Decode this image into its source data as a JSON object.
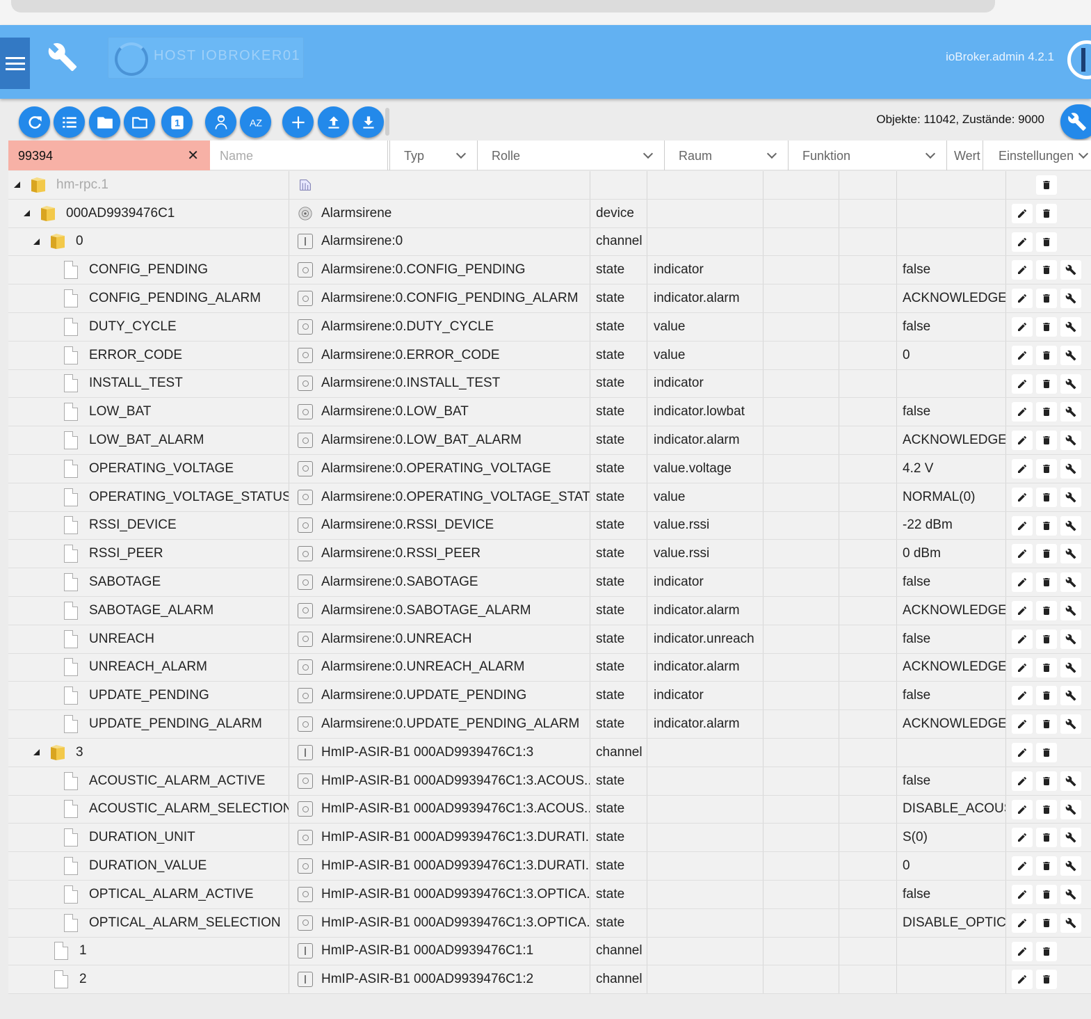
{
  "header": {
    "host_label": "HOST IOBROKER01",
    "version": "ioBroker.admin 4.2.1"
  },
  "toolbar": {
    "buttons": [
      {
        "icon": "refresh-icon"
      },
      {
        "icon": "list-icon"
      },
      {
        "icon": "folder-closed-icon"
      },
      {
        "icon": "folder-open-icon"
      },
      {
        "icon": "one-icon",
        "label": "1"
      },
      {
        "icon": "expert-user-icon"
      },
      {
        "icon": "sort-az-icon",
        "label": "AZ"
      },
      {
        "icon": "add-icon"
      },
      {
        "icon": "upload-icon"
      },
      {
        "icon": "download-icon"
      }
    ],
    "counts": "Objekte: 11042, Zustände: 9000"
  },
  "filters": {
    "id_value": "99394",
    "name_placeholder": "Name",
    "typ": "Typ",
    "rolle": "Rolle",
    "raum": "Raum",
    "funktion": "Funktion",
    "wert": "Wert",
    "einstellungen": "Einstellungen"
  },
  "rows": [
    {
      "level": 0,
      "kind": "folder",
      "id": "hm-rpc.1",
      "name": "",
      "name_icon": "adapter-icon",
      "typ": "",
      "role": "",
      "value": "",
      "actions": [
        "delete"
      ],
      "dim": true
    },
    {
      "level": 1,
      "kind": "folder",
      "id": "000AD9939476C1",
      "name": "Alarmsirene",
      "name_icon": "siren-icon",
      "typ": "device",
      "role": "",
      "value": "",
      "actions": [
        "edit",
        "delete"
      ]
    },
    {
      "level": 2,
      "kind": "folder",
      "id": "0",
      "name": "Alarmsirene:0",
      "name_icon": "channel",
      "typ": "channel",
      "role": "",
      "value": "",
      "actions": [
        "edit",
        "delete"
      ]
    },
    {
      "level": 3,
      "kind": "file",
      "id": "CONFIG_PENDING",
      "name": "Alarmsirene:0.CONFIG_PENDING",
      "name_icon": "state",
      "typ": "state",
      "role": "indicator",
      "value": "false",
      "actions": [
        "edit",
        "delete",
        "config"
      ]
    },
    {
      "level": 3,
      "kind": "file",
      "id": "CONFIG_PENDING_ALARM",
      "name": "Alarmsirene:0.CONFIG_PENDING_ALARM",
      "name_icon": "state",
      "typ": "state",
      "role": "indicator.alarm",
      "value": "ACKNOWLEDGED",
      "actions": [
        "edit",
        "delete",
        "config"
      ]
    },
    {
      "level": 3,
      "kind": "file",
      "id": "DUTY_CYCLE",
      "name": "Alarmsirene:0.DUTY_CYCLE",
      "name_icon": "state",
      "typ": "state",
      "role": "value",
      "value": "false",
      "actions": [
        "edit",
        "delete",
        "config"
      ]
    },
    {
      "level": 3,
      "kind": "file",
      "id": "ERROR_CODE",
      "name": "Alarmsirene:0.ERROR_CODE",
      "name_icon": "state",
      "typ": "state",
      "role": "value",
      "value": "0",
      "actions": [
        "edit",
        "delete",
        "config"
      ]
    },
    {
      "level": 3,
      "kind": "file",
      "id": "INSTALL_TEST",
      "name": "Alarmsirene:0.INSTALL_TEST",
      "name_icon": "state",
      "typ": "state",
      "role": "indicator",
      "value": "",
      "actions": [
        "edit",
        "delete",
        "config"
      ]
    },
    {
      "level": 3,
      "kind": "file",
      "id": "LOW_BAT",
      "name": "Alarmsirene:0.LOW_BAT",
      "name_icon": "state",
      "typ": "state",
      "role": "indicator.lowbat",
      "value": "false",
      "actions": [
        "edit",
        "delete",
        "config"
      ]
    },
    {
      "level": 3,
      "kind": "file",
      "id": "LOW_BAT_ALARM",
      "name": "Alarmsirene:0.LOW_BAT_ALARM",
      "name_icon": "state",
      "typ": "state",
      "role": "indicator.alarm",
      "value": "ACKNOWLEDGED",
      "actions": [
        "edit",
        "delete",
        "config"
      ]
    },
    {
      "level": 3,
      "kind": "file",
      "id": "OPERATING_VOLTAGE",
      "name": "Alarmsirene:0.OPERATING_VOLTAGE",
      "name_icon": "state",
      "typ": "state",
      "role": "value.voltage",
      "value": "4.2 V",
      "actions": [
        "edit",
        "delete",
        "config"
      ]
    },
    {
      "level": 3,
      "kind": "file",
      "id": "OPERATING_VOLTAGE_STATUS",
      "name": "Alarmsirene:0.OPERATING_VOLTAGE_STAT...",
      "name_icon": "state",
      "typ": "state",
      "role": "value",
      "value": "NORMAL(0)",
      "actions": [
        "edit",
        "delete",
        "config"
      ]
    },
    {
      "level": 3,
      "kind": "file",
      "id": "RSSI_DEVICE",
      "name": "Alarmsirene:0.RSSI_DEVICE",
      "name_icon": "state",
      "typ": "state",
      "role": "value.rssi",
      "value": "-22 dBm",
      "actions": [
        "edit",
        "delete",
        "config"
      ]
    },
    {
      "level": 3,
      "kind": "file",
      "id": "RSSI_PEER",
      "name": "Alarmsirene:0.RSSI_PEER",
      "name_icon": "state",
      "typ": "state",
      "role": "value.rssi",
      "value": "0 dBm",
      "actions": [
        "edit",
        "delete",
        "config"
      ]
    },
    {
      "level": 3,
      "kind": "file",
      "id": "SABOTAGE",
      "name": "Alarmsirene:0.SABOTAGE",
      "name_icon": "state",
      "typ": "state",
      "role": "indicator",
      "value": "false",
      "actions": [
        "edit",
        "delete",
        "config"
      ]
    },
    {
      "level": 3,
      "kind": "file",
      "id": "SABOTAGE_ALARM",
      "name": "Alarmsirene:0.SABOTAGE_ALARM",
      "name_icon": "state",
      "typ": "state",
      "role": "indicator.alarm",
      "value": "ACKNOWLEDGED",
      "actions": [
        "edit",
        "delete",
        "config"
      ]
    },
    {
      "level": 3,
      "kind": "file",
      "id": "UNREACH",
      "name": "Alarmsirene:0.UNREACH",
      "name_icon": "state",
      "typ": "state",
      "role": "indicator.unreach",
      "value": "false",
      "actions": [
        "edit",
        "delete",
        "config"
      ]
    },
    {
      "level": 3,
      "kind": "file",
      "id": "UNREACH_ALARM",
      "name": "Alarmsirene:0.UNREACH_ALARM",
      "name_icon": "state",
      "typ": "state",
      "role": "indicator.alarm",
      "value": "ACKNOWLEDGED",
      "actions": [
        "edit",
        "delete",
        "config"
      ]
    },
    {
      "level": 3,
      "kind": "file",
      "id": "UPDATE_PENDING",
      "name": "Alarmsirene:0.UPDATE_PENDING",
      "name_icon": "state",
      "typ": "state",
      "role": "indicator",
      "value": "false",
      "actions": [
        "edit",
        "delete",
        "config"
      ]
    },
    {
      "level": 3,
      "kind": "file",
      "id": "UPDATE_PENDING_ALARM",
      "name": "Alarmsirene:0.UPDATE_PENDING_ALARM",
      "name_icon": "state",
      "typ": "state",
      "role": "indicator.alarm",
      "value": "ACKNOWLEDGED",
      "actions": [
        "edit",
        "delete",
        "config"
      ]
    },
    {
      "level": 2,
      "kind": "folder",
      "id": "3",
      "name": "HmIP-ASIR-B1 000AD9939476C1:3",
      "name_icon": "channel",
      "typ": "channel",
      "role": "",
      "value": "",
      "actions": [
        "edit",
        "delete"
      ]
    },
    {
      "level": 3,
      "kind": "file",
      "id": "ACOUSTIC_ALARM_ACTIVE",
      "name": "HmIP-ASIR-B1 000AD9939476C1:3.ACOUS...",
      "name_icon": "state",
      "typ": "state",
      "role": "",
      "value": "false",
      "actions": [
        "edit",
        "delete",
        "config"
      ]
    },
    {
      "level": 3,
      "kind": "file",
      "id": "ACOUSTIC_ALARM_SELECTION",
      "name": "HmIP-ASIR-B1 000AD9939476C1:3.ACOUS...",
      "name_icon": "state",
      "typ": "state",
      "role": "",
      "value": "DISABLE_ACOUS",
      "actions": [
        "edit",
        "delete",
        "config"
      ]
    },
    {
      "level": 3,
      "kind": "file",
      "id": "DURATION_UNIT",
      "name": "HmIP-ASIR-B1 000AD9939476C1:3.DURATI...",
      "name_icon": "state",
      "typ": "state",
      "role": "",
      "value": "S(0)",
      "actions": [
        "edit",
        "delete",
        "config"
      ]
    },
    {
      "level": 3,
      "kind": "file",
      "id": "DURATION_VALUE",
      "name": "HmIP-ASIR-B1 000AD9939476C1:3.DURATI...",
      "name_icon": "state",
      "typ": "state",
      "role": "",
      "value": "0",
      "actions": [
        "edit",
        "delete",
        "config"
      ]
    },
    {
      "level": 3,
      "kind": "file",
      "id": "OPTICAL_ALARM_ACTIVE",
      "name": "HmIP-ASIR-B1 000AD9939476C1:3.OPTICA...",
      "name_icon": "state",
      "typ": "state",
      "role": "",
      "value": "false",
      "actions": [
        "edit",
        "delete",
        "config"
      ]
    },
    {
      "level": 3,
      "kind": "file",
      "id": "OPTICAL_ALARM_SELECTION",
      "name": "HmIP-ASIR-B1 000AD9939476C1:3.OPTICA...",
      "name_icon": "state",
      "typ": "state",
      "role": "",
      "value": "DISABLE_OPTICA",
      "actions": [
        "edit",
        "delete",
        "config"
      ]
    },
    {
      "level": 2,
      "kind": "file",
      "id": "1",
      "name": "HmIP-ASIR-B1 000AD9939476C1:1",
      "name_icon": "channel",
      "typ": "channel",
      "role": "",
      "value": "",
      "actions": [
        "edit",
        "delete"
      ]
    },
    {
      "level": 2,
      "kind": "file",
      "id": "2",
      "name": "HmIP-ASIR-B1 000AD9939476C1:2",
      "name_icon": "channel",
      "typ": "channel",
      "role": "",
      "value": "",
      "actions": [
        "edit",
        "delete"
      ]
    }
  ]
}
